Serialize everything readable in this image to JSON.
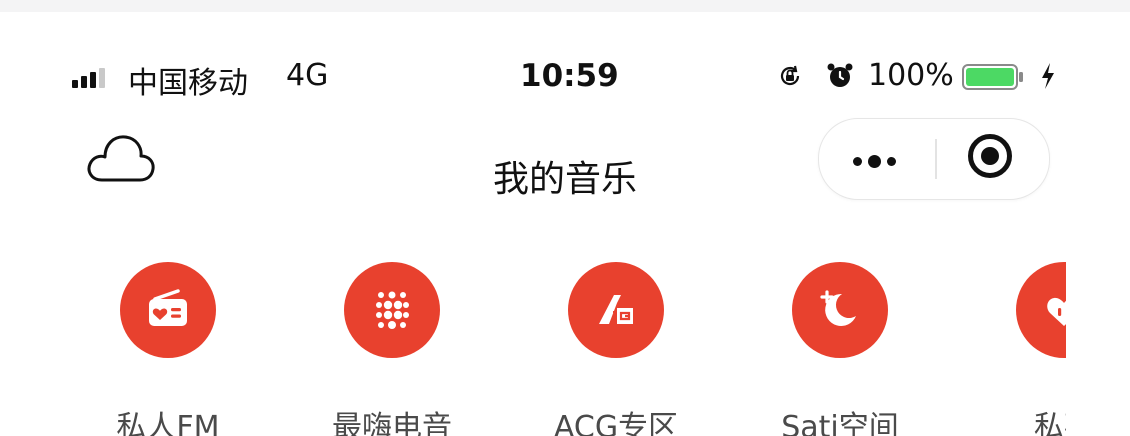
{
  "status_bar": {
    "carrier": "中国移动",
    "network": "4G",
    "time": "10:59",
    "battery_percent": "100%",
    "battery_level": 1.0,
    "battery_color": "#4cd964"
  },
  "nav": {
    "title": "我的音乐",
    "left_icon": "cloud-icon",
    "capsule_icons": [
      "more-dots-icon",
      "close-target-icon"
    ]
  },
  "colors": {
    "accent": "#e8412e"
  },
  "entries": [
    {
      "label": "私人FM",
      "icon": "radio-heart-icon"
    },
    {
      "label": "最嗨电音",
      "icon": "dot-grid-icon"
    },
    {
      "label": "ACG专区",
      "icon": "acg-logo-icon"
    },
    {
      "label": "Sati空间",
      "icon": "moon-plus-icon"
    },
    {
      "label": "私藏",
      "icon": "heart-bubble-icon"
    }
  ]
}
